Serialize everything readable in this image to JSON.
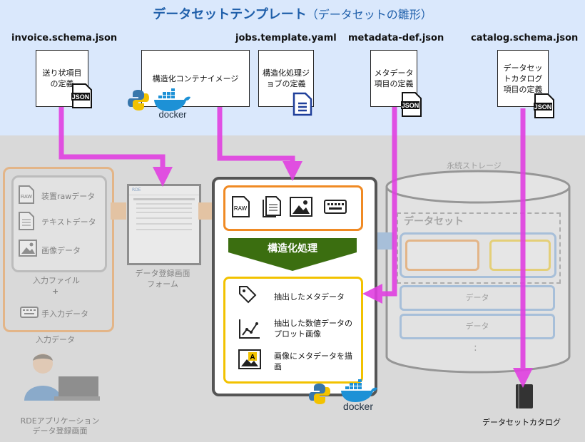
{
  "title": {
    "main": "データセットテンプレート",
    "sub": "（データセットの雛形）"
  },
  "files": {
    "invoice_name": "invoice.schema.json",
    "jobs_name": "jobs.template.yaml",
    "metadata_name": "metadata-def.json",
    "catalog_name": "catalog.schema.json"
  },
  "docs": {
    "invoice": "送り状項目の定義",
    "container": "構造化コンテナイメージ",
    "jobs": "構造化処理ジョブの定義",
    "metadata": "メタデータ項目の定義",
    "catalog": "データセットカタログ項目の定義"
  },
  "badges": {
    "json": "JSON",
    "docker": "docker",
    "raw": "RAW",
    "rde": "RDE"
  },
  "input": {
    "items": [
      "装置rawデータ",
      "テキストデータ",
      "画像データ"
    ],
    "file_label": "入力ファイル",
    "plus": "+",
    "manual": "手入力データ",
    "caption": "入力データ"
  },
  "form": {
    "caption_line1": "データ登録画面",
    "caption_line2": "フォーム"
  },
  "process": {
    "label": "構造化処理",
    "outputs": [
      "抽出したメタデータ",
      "抽出した数値データのプロット画像",
      "画像にメタデータを描画"
    ]
  },
  "storage": {
    "title": "永続ストレージ",
    "dataset": "データセット",
    "data_rows": [
      "データ",
      "データ"
    ],
    "dots": ":"
  },
  "app": {
    "line1": "RDEアプリケーション",
    "line2": "データ登録画面"
  },
  "catalog_caption": "データセットカタログ",
  "colors": {
    "magenta": "#e040e0",
    "green": "#3b6e10",
    "yellow": "#f2c200",
    "orange": "#f08a24",
    "blue": "#1f5faa"
  }
}
